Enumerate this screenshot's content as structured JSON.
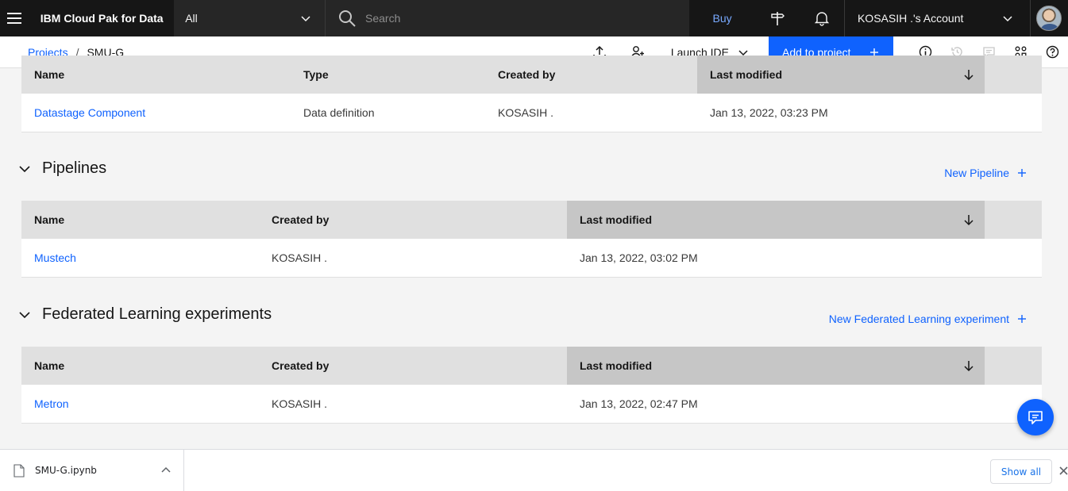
{
  "topbar": {
    "brand": "IBM Cloud Pak for Data",
    "scope": "All",
    "search_placeholder": "Search",
    "buy": "Buy",
    "account": "KOSASIH .'s Account"
  },
  "subbar": {
    "breadcrumb_root": "Projects",
    "breadcrumb_sep": "/",
    "breadcrumb_current": "SMU-G",
    "launch_ide": "Launch IDE",
    "add_to_project": "Add to project"
  },
  "data_definitions": {
    "columns": [
      "Name",
      "Type",
      "Created by",
      "Last modified"
    ],
    "rows": [
      {
        "name": "Datastage Component",
        "type": "Data definition",
        "created_by": "KOSASIH .",
        "last_modified": "Jan 13, 2022, 03:23 PM"
      }
    ]
  },
  "pipelines": {
    "title": "Pipelines",
    "action": "New Pipeline",
    "columns": [
      "Name",
      "Created by",
      "Last modified"
    ],
    "rows": [
      {
        "name": "Mustech",
        "created_by": "KOSASIH .",
        "last_modified": "Jan 13, 2022, 03:02 PM"
      }
    ]
  },
  "federated": {
    "title": "Federated Learning experiments",
    "action": "New Federated Learning experiment",
    "columns": [
      "Name",
      "Created by",
      "Last modified"
    ],
    "rows": [
      {
        "name": "Metron",
        "created_by": "KOSASIH .",
        "last_modified": "Jan 13, 2022, 02:47 PM"
      }
    ]
  },
  "downloads": {
    "file": "SMU-G.ipynb",
    "show_all": "Show all"
  },
  "colors": {
    "topbar_bg": "#161616",
    "primary": "#0f62fe",
    "link": "#0f62fe",
    "header_bg": "#e0e0e0",
    "sorted_header_bg": "#c6c6c6"
  }
}
